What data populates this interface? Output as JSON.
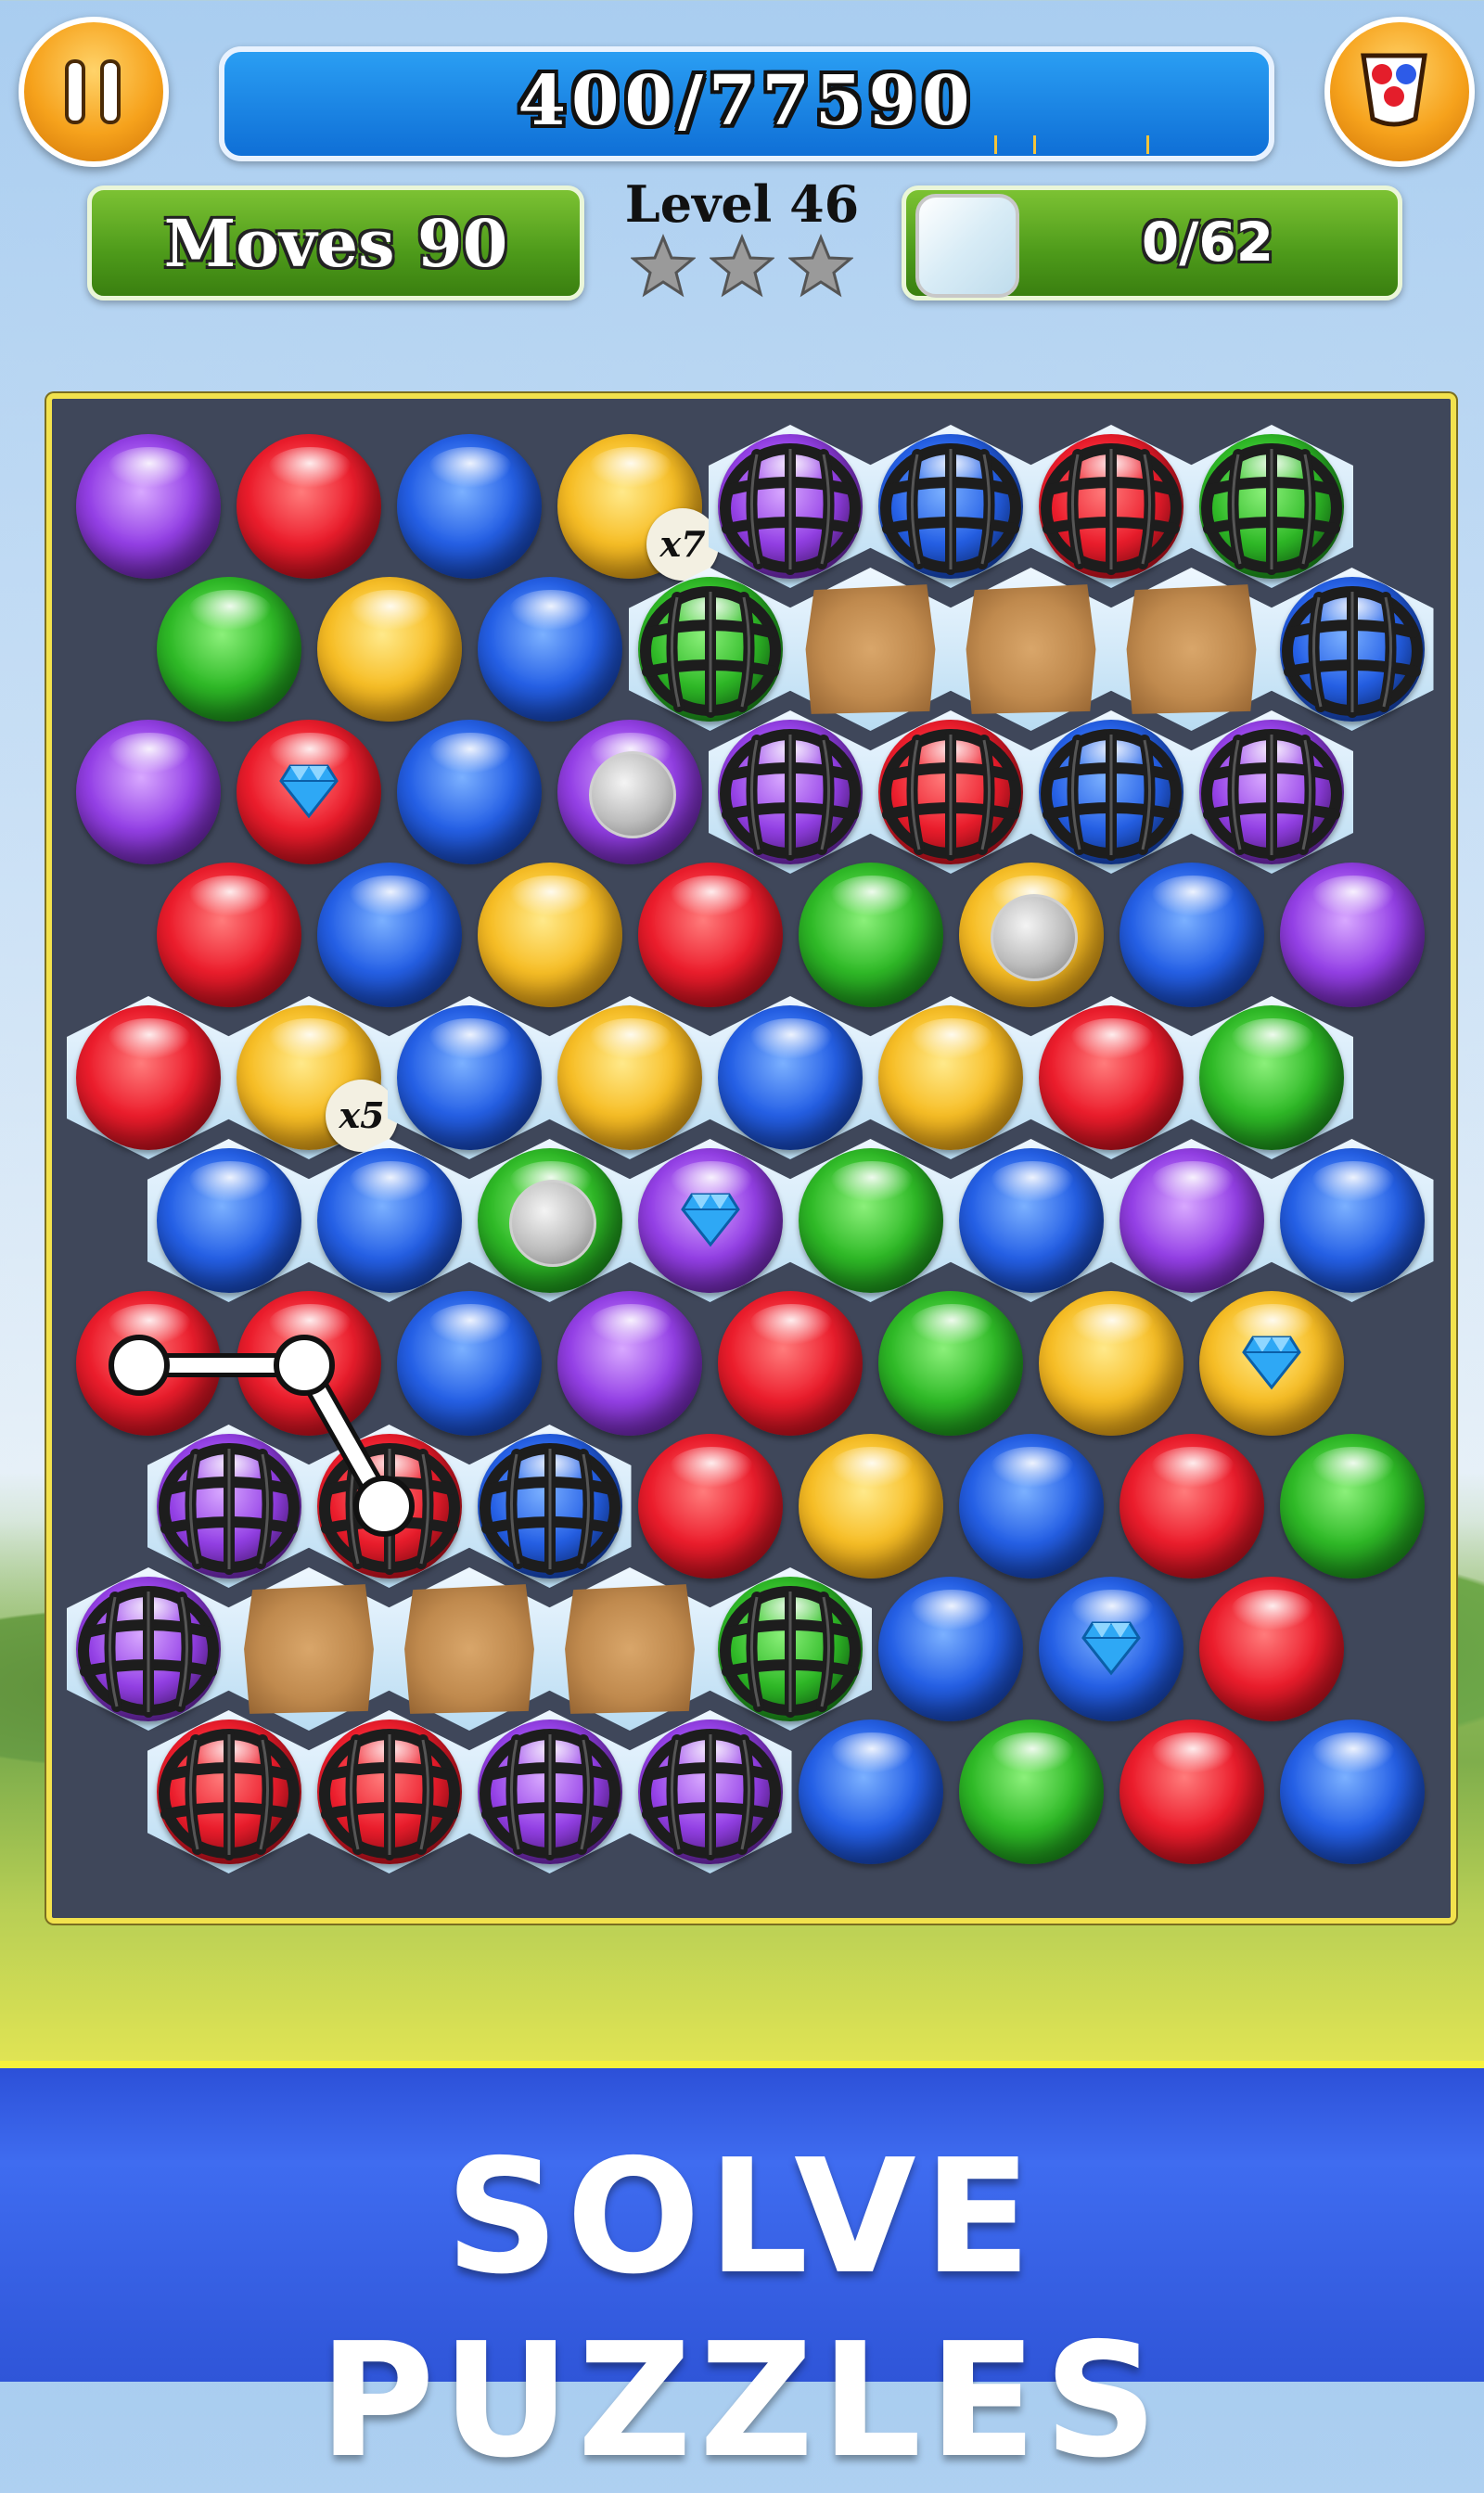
{
  "hud": {
    "score": "400/77590",
    "moves": "Moves 90",
    "level": "Level 46",
    "stars_earned": 0,
    "stars_total": 3,
    "ice_progress": "0/62"
  },
  "board": {
    "rows": [
      [
        "purple",
        "red",
        "blue",
        "yellow:x7",
        "cage-purple",
        "cage-blue",
        "cage-red",
        "cage-green"
      ],
      [
        "green",
        "yellow",
        "blue",
        "cage-green",
        "rock",
        "rock",
        "rock",
        "cage-blue"
      ],
      [
        "purple",
        "red:gem",
        "blue",
        "purple:coin",
        "cage-purple",
        "cage-red",
        "cage-blue",
        "cage-purple"
      ],
      [
        "red",
        "blue",
        "yellow",
        "red",
        "green",
        "yellow:coin",
        "blue",
        "purple"
      ],
      [
        "red",
        "yellow:x5",
        "blue",
        "yellow",
        "blue",
        "yellow",
        "red",
        "green"
      ],
      [
        "blue",
        "blue",
        "green:coin",
        "purple:gem",
        "green",
        "blue",
        "purple",
        "blue"
      ],
      [
        "red",
        "red",
        "blue",
        "purple",
        "red",
        "green",
        "yellow",
        "yellow:gem"
      ],
      [
        "cage-purple",
        "cage-red",
        "cage-blue",
        "red",
        "yellow",
        "blue",
        "red",
        "green"
      ],
      [
        "cage-purple",
        "rock",
        "rock",
        "rock",
        "cage-green",
        "blue",
        "blue:gem",
        "red"
      ],
      [
        "cage-red",
        "cage-red",
        "cage-purple",
        "cage-purple",
        "blue",
        "green",
        "red",
        "blue"
      ]
    ]
  },
  "footer": {
    "headline": "SOLVE PUZZLES"
  }
}
